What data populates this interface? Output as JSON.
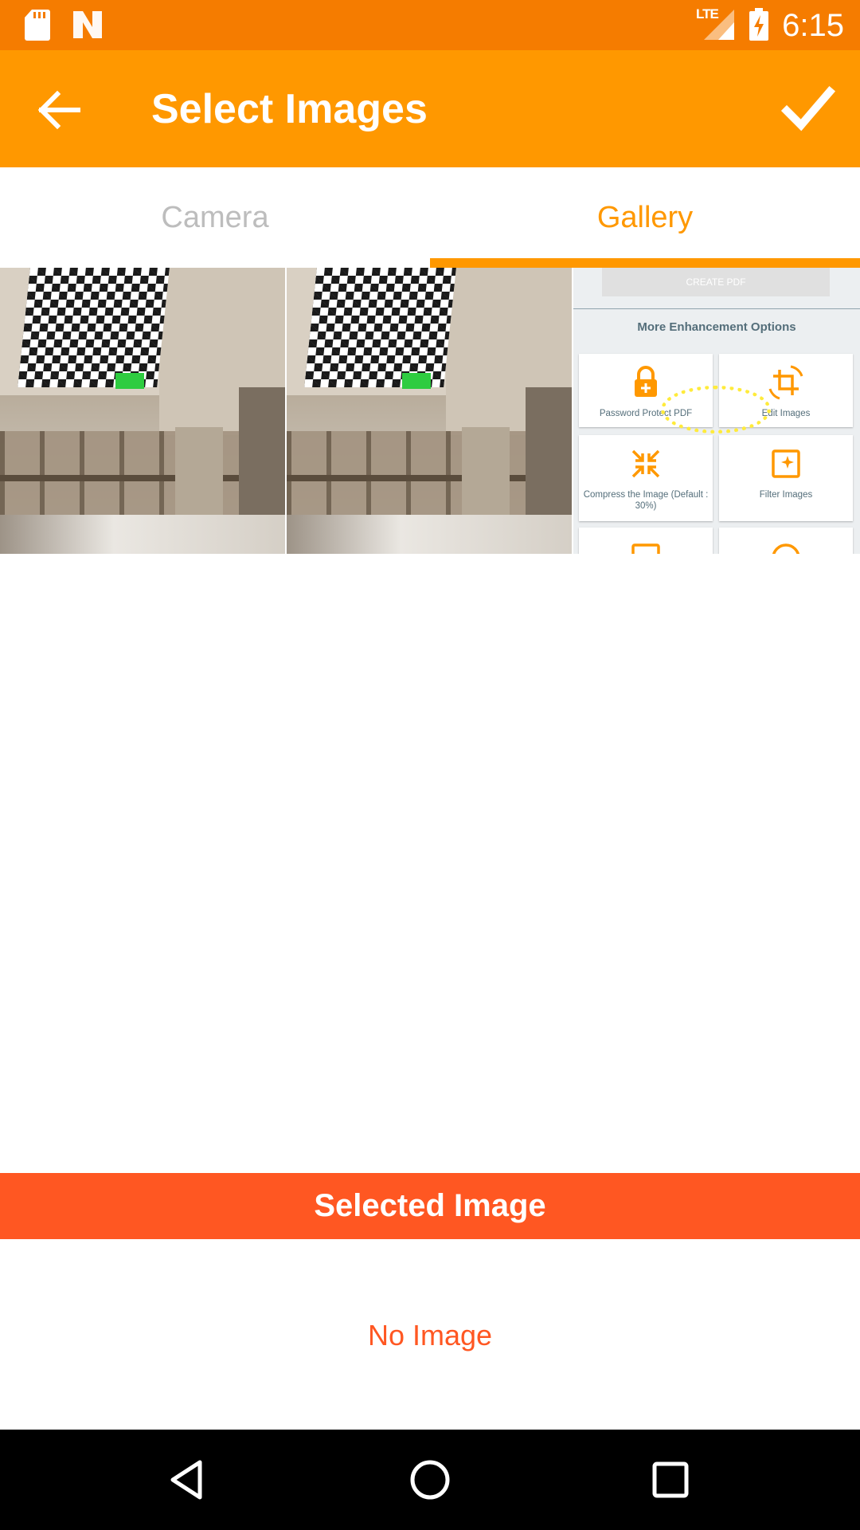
{
  "status_bar": {
    "time": "6:15",
    "network": "LTE",
    "icons": [
      "sd-card-icon",
      "notification-n-icon",
      "lte-signal-icon",
      "battery-charging-icon"
    ]
  },
  "app_bar": {
    "title": "Select Images",
    "icons": [
      "back-arrow-icon",
      "check-icon"
    ]
  },
  "tabs": [
    {
      "label": "Camera",
      "selected": false
    },
    {
      "label": "Gallery",
      "selected": true
    }
  ],
  "gallery": {
    "items": [
      {
        "kind": "photo"
      },
      {
        "kind": "photo"
      },
      {
        "kind": "screenshot",
        "create_pdf_label": "CREATE PDF",
        "heading": "More Enhancement Options",
        "options": [
          {
            "label": "Password Protect PDF",
            "icon": "lock-icon"
          },
          {
            "label": "Edit Images",
            "icon": "crop-rotate-icon"
          },
          {
            "label": "Compress the Image (Default : 30%)",
            "icon": "compress-icon"
          },
          {
            "label": "Filter Images",
            "icon": "filter-icon"
          }
        ]
      }
    ]
  },
  "selected": {
    "header": "Selected Image",
    "empty_text": "No Image"
  },
  "colors": {
    "status_bar": "#F57C00",
    "app_bar": "#FF9800",
    "accent": "#FF9800",
    "selected_bar": "#FF5722",
    "empty_text": "#FF5722",
    "nav_bar": "#000000"
  },
  "nav_bar": {
    "icons": [
      "nav-back-icon",
      "nav-home-icon",
      "nav-recent-apps-icon"
    ]
  }
}
